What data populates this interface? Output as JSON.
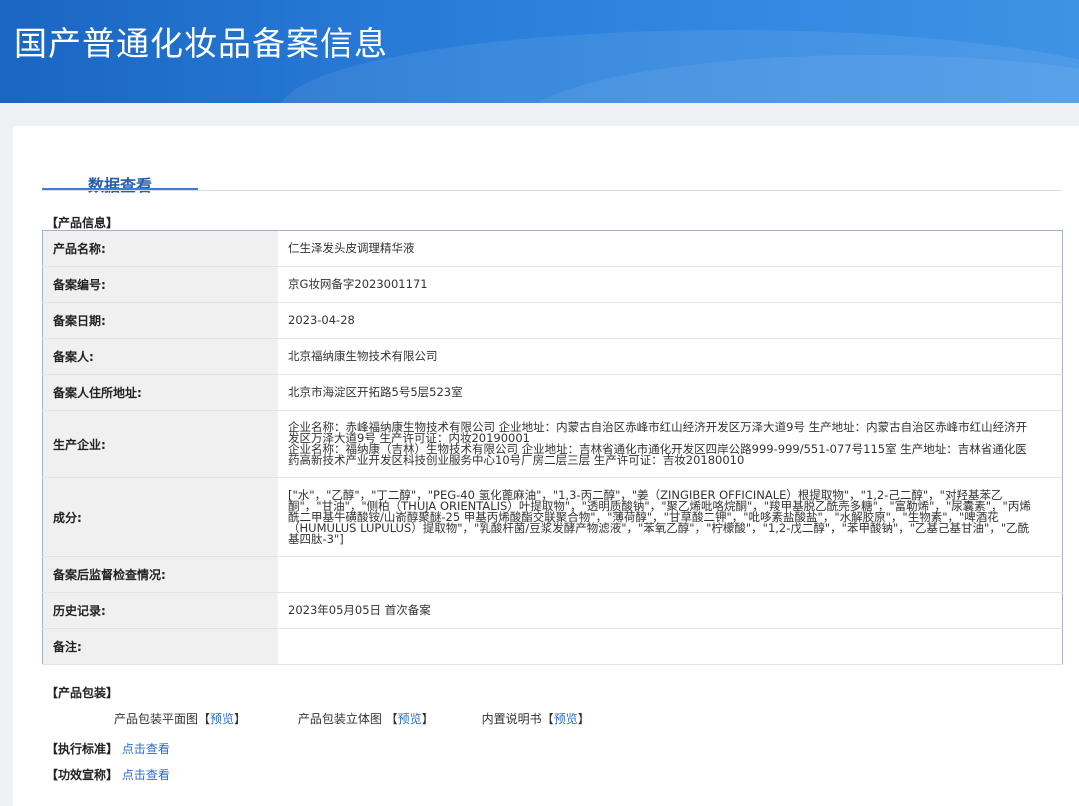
{
  "page_title": "国产普通化妆品备案信息",
  "tab": "数据查看",
  "product_info": {
    "heading": "【产品信息】",
    "rows": [
      {
        "label": "产品名称:",
        "value": "仁生泽发头皮调理精华液"
      },
      {
        "label": "备案编号:",
        "value": "京G妆网备字2023001171"
      },
      {
        "label": "备案日期:",
        "value": "2023-04-28"
      },
      {
        "label": "备案人:",
        "value": "北京福纳康生物技术有限公司"
      },
      {
        "label": "备案人住所地址:",
        "value": "北京市海淀区开拓路5号5层523室"
      },
      {
        "label": "生产企业:",
        "value": "企业名称：赤峰福纳康生物技术有限公司 企业地址：内蒙古自治区赤峰市红山经济开发区万泽大道9号 生产地址：内蒙古自治区赤峰市红山经济开发区万泽大道9号 生产许可证：内妆20190001\n企业名称：福纳康（吉林）生物技术有限公司 企业地址：吉林省通化市通化开发区四岸公路999-999/551-077号115室 生产地址：吉林省通化医药高新技术产业开发区科技创业服务中心10号厂房二层三层 生产许可证：吉妆20180010"
      },
      {
        "label": "成分:",
        "value": "[\"水\"，\"乙醇\"，\"丁二醇\"，\"PEG-40 氢化蓖麻油\"，\"1,3-丙二醇\"，\"姜（ZINGIBER OFFICINALE）根提取物\"，\"1,2-己二醇\"，\"对羟基苯乙酮\"，\"甘油\"，\"侧柏（THUJA ORIENTALIS）叶提取物\"，\"透明质酸钠\"，\"聚乙烯吡咯烷酮\"，\"羧甲基脱乙酰壳多糖\"，\"富勒烯\"，\"尿囊素\"，\"丙烯酰二甲基牛磺酸铵/山嵛醇聚醚-25 甲基丙烯酸酯交联聚合物\"，\"薄荷醇\"，\"甘草酸二钾\"，\"吡哆素盐酸盐\"，\"水解胶原\"，\"生物素\"，\"啤酒花（HUMULUS LUPULUS）提取物\"，\"乳酸杆菌/豆浆发酵产物滤液\"，\"苯氧乙醇\"，\"柠檬酸\"，\"1,2-戊二醇\"，\"苯甲酸钠\"，\"乙基己基甘油\"，\"乙酰基四肽-3\"]"
      },
      {
        "label": "备案后监督检查情况:",
        "value": ""
      },
      {
        "label": "历史记录:",
        "value": "2023年05月05日 首次备案"
      },
      {
        "label": "备注:",
        "value": ""
      }
    ]
  },
  "packaging": {
    "heading": "【产品包装】",
    "items": [
      {
        "label": "产品包装平面图",
        "link": "预览"
      },
      {
        "label": "产品包装立体图",
        "link": "预览"
      },
      {
        "label": "内置说明书",
        "link": "预览"
      }
    ]
  },
  "standard": {
    "label": "【执行标准】",
    "link": "点击查看"
  },
  "efficacy": {
    "label": "【功效宣称】",
    "link": "点击查看"
  },
  "colors": {
    "banner": "#2a7fdb",
    "tab": "#2a5ea8",
    "link": "#2a6fc5",
    "label_bg": "#f0f0f0"
  }
}
